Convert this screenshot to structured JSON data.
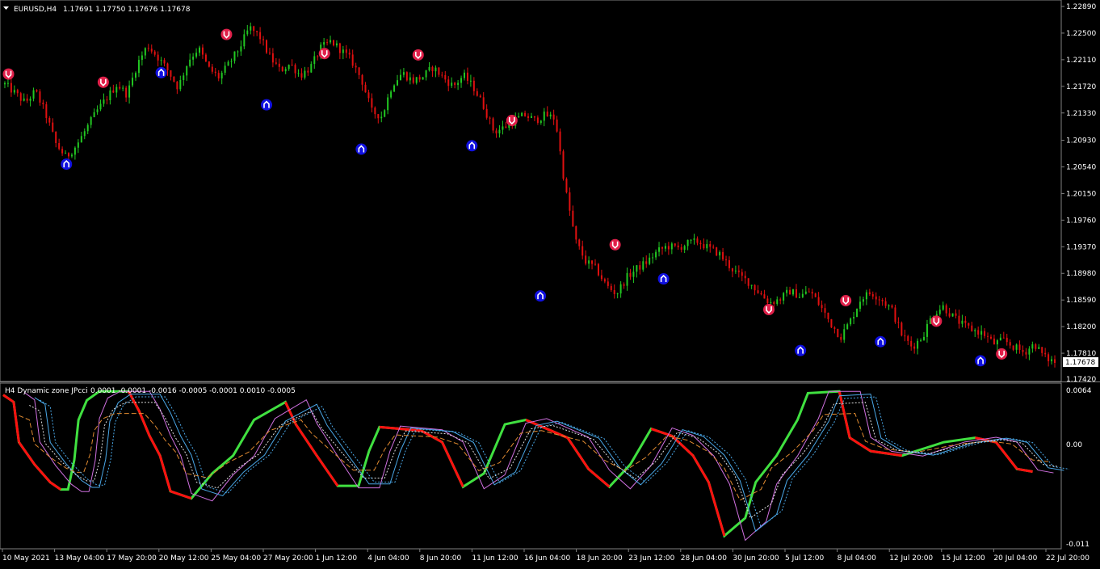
{
  "window": {
    "symbol_line": "EURUSD,H4",
    "ohlc": "1.17691 1.17750 1.17676 1.17678",
    "menu_icon": "triangle-down-icon"
  },
  "indicator": {
    "title": "H4 Dynamic zone JPcci",
    "values": "0.0001 -0.0001 -0.0016 -0.0005 -0.0001 0.0010 -0.0005",
    "scale_labels": [
      "0.0064",
      "0.00",
      "-0.011"
    ]
  },
  "price_axis": {
    "labels": [
      "1.22890",
      "1.22500",
      "1.22110",
      "1.21720",
      "1.21330",
      "1.20930",
      "1.20540",
      "1.20150",
      "1.19760",
      "1.19370",
      "1.18980",
      "1.18590",
      "1.18200",
      "1.17810"
    ],
    "current_price": "1.17678",
    "bottom_label": "1.17420"
  },
  "time_axis": {
    "labels": [
      "10 May 2021",
      "13 May 04:00",
      "17 May 20:00",
      "20 May 12:00",
      "25 May 04:00",
      "27 May 20:00",
      "1 Jun 12:00",
      "4 Jun 04:00",
      "8 Jun 20:00",
      "11 Jun 12:00",
      "16 Jun 04:00",
      "18 Jun 20:00",
      "23 Jun 12:00",
      "28 Jun 04:00",
      "30 Jun 20:00",
      "5 Jul 12:00",
      "8 Jul 04:00",
      "12 Jul 20:00",
      "15 Jul 12:00",
      "20 Jul 04:00",
      "22 Jul 20:00"
    ]
  },
  "colors": {
    "background": "#000000",
    "bull": "#22c722",
    "bear": "#e01010",
    "arrow_up": "#1010e0",
    "arrow_down": "#e0204a",
    "grid": "#808080",
    "line_green": "#40e040",
    "line_red": "#ff1010",
    "line_blue": "#4aa8e8",
    "line_violet": "#d070e0",
    "line_orange": "#e08a30",
    "line_white": "#e0e0e0"
  },
  "chart_data": {
    "type": "candlestick",
    "price_path": [
      1.2175,
      1.2162,
      1.2148,
      1.2165,
      1.2132,
      1.2088,
      1.2068,
      1.2085,
      1.211,
      1.2135,
      1.2155,
      1.2175,
      1.216,
      1.2205,
      1.2232,
      1.2215,
      1.2195,
      1.217,
      1.221,
      1.2228,
      1.2198,
      1.2185,
      1.2205,
      1.2228,
      1.2258,
      1.2245,
      1.2215,
      1.2195,
      1.2205,
      1.2188,
      1.22,
      1.2228,
      1.2238,
      1.2225,
      1.221,
      1.2182,
      1.2135,
      1.2128,
      1.2175,
      1.2192,
      1.218,
      1.2186,
      1.22,
      1.2185,
      1.2172,
      1.2188,
      1.217,
      1.2142,
      1.2105,
      1.2112,
      1.2122,
      1.213,
      1.2122,
      1.213,
      1.2125,
      1.202,
      1.1945,
      1.1915,
      1.1905,
      1.188,
      1.1868,
      1.1892,
      1.1905,
      1.1915,
      1.193,
      1.1938,
      1.1935,
      1.1942,
      1.1945,
      1.1935,
      1.1928,
      1.191,
      1.1895,
      1.1885,
      1.187,
      1.1855,
      1.186,
      1.1872,
      1.1865,
      1.1872,
      1.185,
      1.1825,
      1.1805,
      1.183,
      1.1862,
      1.187,
      1.186,
      1.1845,
      1.1808,
      1.179,
      1.1805,
      1.1838,
      1.185,
      1.1835,
      1.1822,
      1.1815,
      1.181,
      1.1795,
      1.18,
      1.179,
      1.1782,
      1.1795,
      1.1775,
      1.1768
    ],
    "signals_up": [
      [
        0.06,
        1.2058
      ],
      [
        0.15,
        1.2192
      ],
      [
        0.25,
        1.2145
      ],
      [
        0.34,
        1.208
      ],
      [
        0.445,
        1.2085
      ],
      [
        0.51,
        1.1865
      ],
      [
        0.627,
        1.189
      ],
      [
        0.757,
        1.1785
      ],
      [
        0.833,
        1.1798
      ],
      [
        0.928,
        1.177
      ]
    ],
    "signals_down": [
      [
        0.005,
        1.219
      ],
      [
        0.095,
        1.2178
      ],
      [
        0.212,
        1.2248
      ],
      [
        0.305,
        1.222
      ],
      [
        0.394,
        1.2218
      ],
      [
        0.483,
        1.2122
      ],
      [
        0.581,
        1.194
      ],
      [
        0.727,
        1.1845
      ],
      [
        0.8,
        1.1858
      ],
      [
        0.886,
        1.1828
      ],
      [
        0.948,
        1.178
      ]
    ],
    "oscillator_range": [
      -0.011,
      0.0064
    ]
  }
}
